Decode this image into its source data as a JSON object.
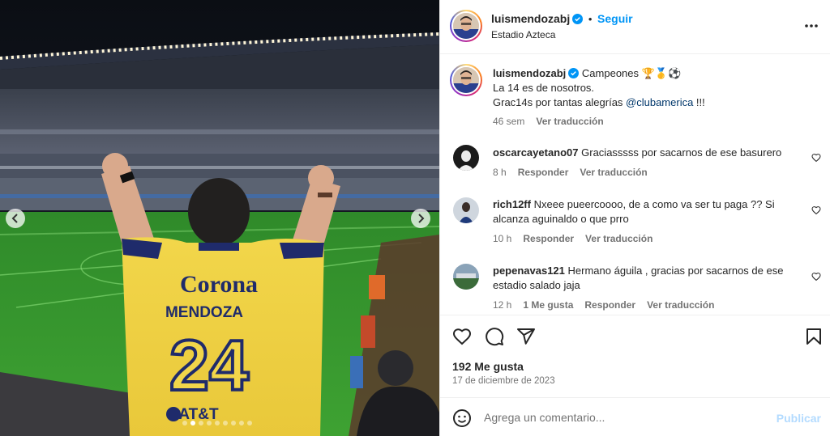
{
  "post": {
    "carousel": {
      "slide_count": 9,
      "active_slide": 2
    },
    "header": {
      "username": "luismendozabj",
      "follow_label": "Seguir",
      "location": "Estadio Azteca",
      "more_icon": "more-horizontal-icon"
    },
    "caption": {
      "username": "luismendozabj",
      "line1_after_user": "Campeones 🏆🥇⚽",
      "line2": "La 14 es de nosotros.",
      "line3_prefix": "Grac14s por tantas alegrías ",
      "line3_mention": "@clubamerica",
      "line3_suffix": " !!!",
      "time": "46 sem",
      "translate": "Ver traducción"
    },
    "comments": [
      {
        "username": "oscarcayetano07",
        "text": "Graciasssss por sacarnos de ese basurero",
        "time": "8 h",
        "reply": "Responder",
        "translate": "Ver traducción"
      },
      {
        "username": "rich12ff",
        "text": "Nxeee pueercoooo, de a como va ser tu paga ?? Si alcanza aguinaldo o que prro",
        "time": "10 h",
        "reply": "Responder",
        "translate": "Ver traducción"
      },
      {
        "username": "pepenavas121",
        "text": "Hermano águila , gracias por sacarnos de ese estadio salado jaja",
        "time": "12 h",
        "likes": "1 Me gusta",
        "reply": "Responder",
        "translate": "Ver traducción"
      }
    ],
    "likes": "192 Me gusta",
    "date": "17 de diciembre de 2023",
    "composer": {
      "placeholder": "Agrega un comentario...",
      "publish": "Publicar"
    },
    "colors": {
      "accent": "#0095f6",
      "mention": "#00376b",
      "secondary_text": "#737373",
      "publish_disabled": "#b3dbff"
    }
  }
}
